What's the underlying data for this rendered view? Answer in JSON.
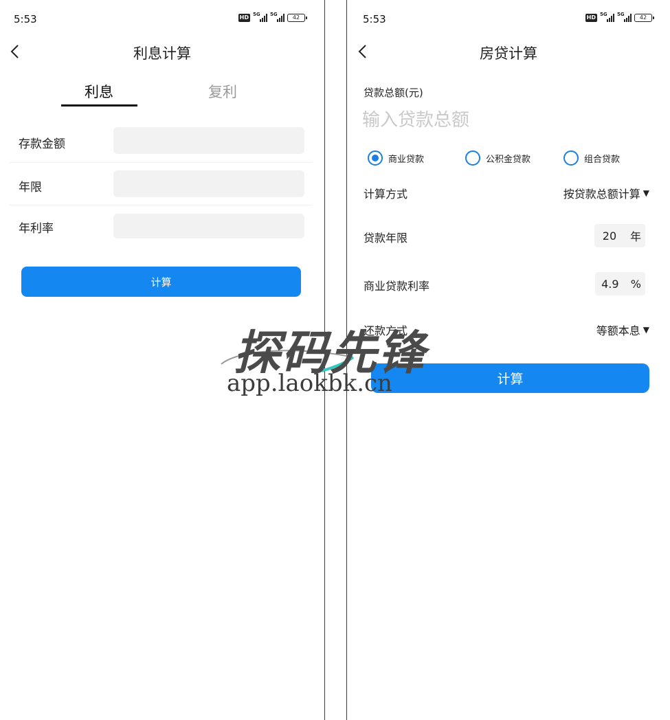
{
  "left": {
    "status": {
      "time": "5:53",
      "hd": "HD",
      "net1": "5G",
      "net2": "5G",
      "battery": "42"
    },
    "title": "利息计算",
    "tabs": [
      {
        "label": "利息"
      },
      {
        "label": "复利"
      }
    ],
    "fields": [
      {
        "label": "存款金额",
        "value": ""
      },
      {
        "label": "年限",
        "value": ""
      },
      {
        "label": "年利率",
        "value": ""
      }
    ],
    "calc_label": "计算"
  },
  "right": {
    "status": {
      "time": "5:53",
      "hd": "HD",
      "net1": "5G",
      "net2": "5G",
      "battery": "42"
    },
    "title": "房贷计算",
    "amount_label": "贷款总额(元)",
    "amount_placeholder": "输入贷款总额",
    "loan_types": [
      {
        "label": "商业贷款"
      },
      {
        "label": "公积金贷款"
      },
      {
        "label": "组合贷款"
      }
    ],
    "selected_loan_type": "商业贷款",
    "calc_method_label": "计算方式",
    "calc_method_value": "按贷款总额计算",
    "years_label": "贷款年限",
    "years_value": "20",
    "years_unit": "年",
    "rate_label": "商业贷款利率",
    "rate_value": "4.9",
    "rate_unit": "%",
    "repay_label": "还款方式",
    "repay_value": "等额本息",
    "calc_label": "计算"
  },
  "watermark": {
    "logo": "探码先锋",
    "url": "app.laokbk.cn"
  },
  "colors": {
    "primary": "#1488f0",
    "radio": "#1a7fe0",
    "input_bg": "#f2f2f2",
    "placeholder": "#c9c9c9"
  }
}
